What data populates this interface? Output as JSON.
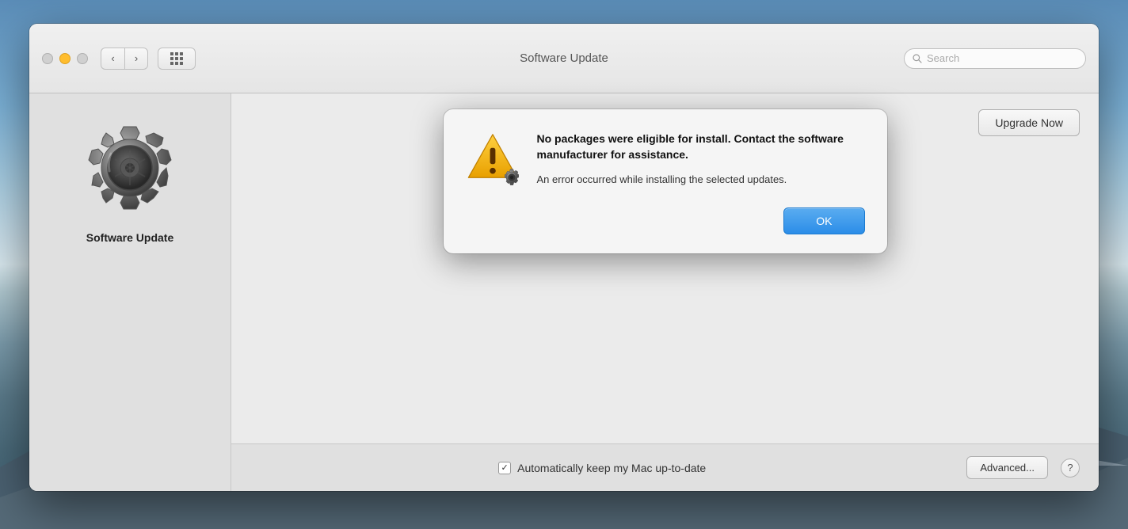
{
  "background": {
    "color_top": "#5b8db8",
    "color_bottom": "#3a5a6a"
  },
  "window": {
    "title": "Software Update",
    "traffic_lights": {
      "close_label": "close",
      "minimize_label": "minimize",
      "maximize_label": "maximize"
    },
    "nav": {
      "back_label": "‹",
      "forward_label": "›",
      "grid_label": "grid view"
    },
    "search": {
      "placeholder": "Search"
    }
  },
  "sidebar": {
    "icon_label": "software-update-icon",
    "label": "Software Update"
  },
  "main": {
    "upgrade_button_label": "Upgrade Now"
  },
  "bottom_bar": {
    "checkbox_checked": true,
    "checkbox_label": "Automatically keep my Mac up-to-date",
    "advanced_button_label": "Advanced...",
    "help_button_label": "?"
  },
  "modal": {
    "title": "No packages were eligible for install. Contact the software manufacturer for assistance.",
    "description": "An error occurred while installing the selected updates.",
    "ok_button_label": "OK"
  }
}
